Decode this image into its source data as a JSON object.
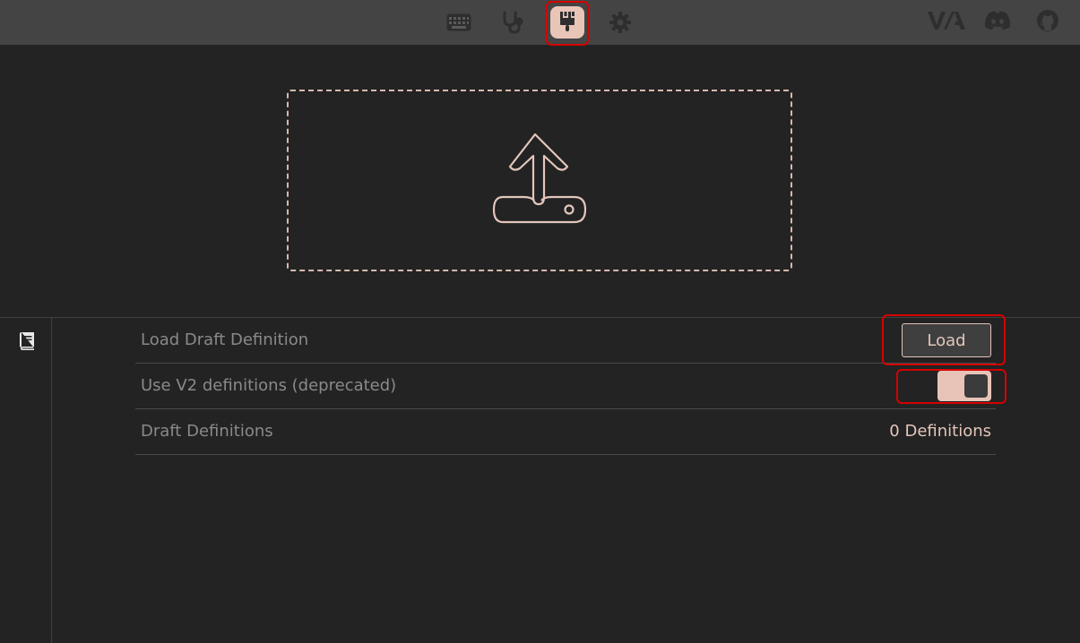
{
  "colors": {
    "background": "#232323",
    "topbar": "#444444",
    "accent": "#e9c5b8",
    "label_text": "#8a8a8a",
    "value_text": "#e3c6bb",
    "highlight": "#d60000"
  },
  "topbar": {
    "nav": [
      {
        "name": "keyboard-icon",
        "active": false
      },
      {
        "name": "stethoscope-icon",
        "active": false
      },
      {
        "name": "paintbrush-icon",
        "active": true
      },
      {
        "name": "gear-icon",
        "active": false
      }
    ],
    "external": [
      {
        "name": "via-logo",
        "label": "V/A"
      },
      {
        "name": "discord-icon"
      },
      {
        "name": "github-icon"
      }
    ]
  },
  "upload": {
    "icon": "upload-icon"
  },
  "sidebar": {
    "tab_icon": "book-icon"
  },
  "settings": {
    "load_draft": {
      "label": "Load Draft Definition",
      "button_label": "Load"
    },
    "use_v2": {
      "label": "Use V2 definitions (deprecated)",
      "enabled": true
    },
    "draft_definitions": {
      "label": "Draft Definitions",
      "value": "0 Definitions"
    }
  }
}
